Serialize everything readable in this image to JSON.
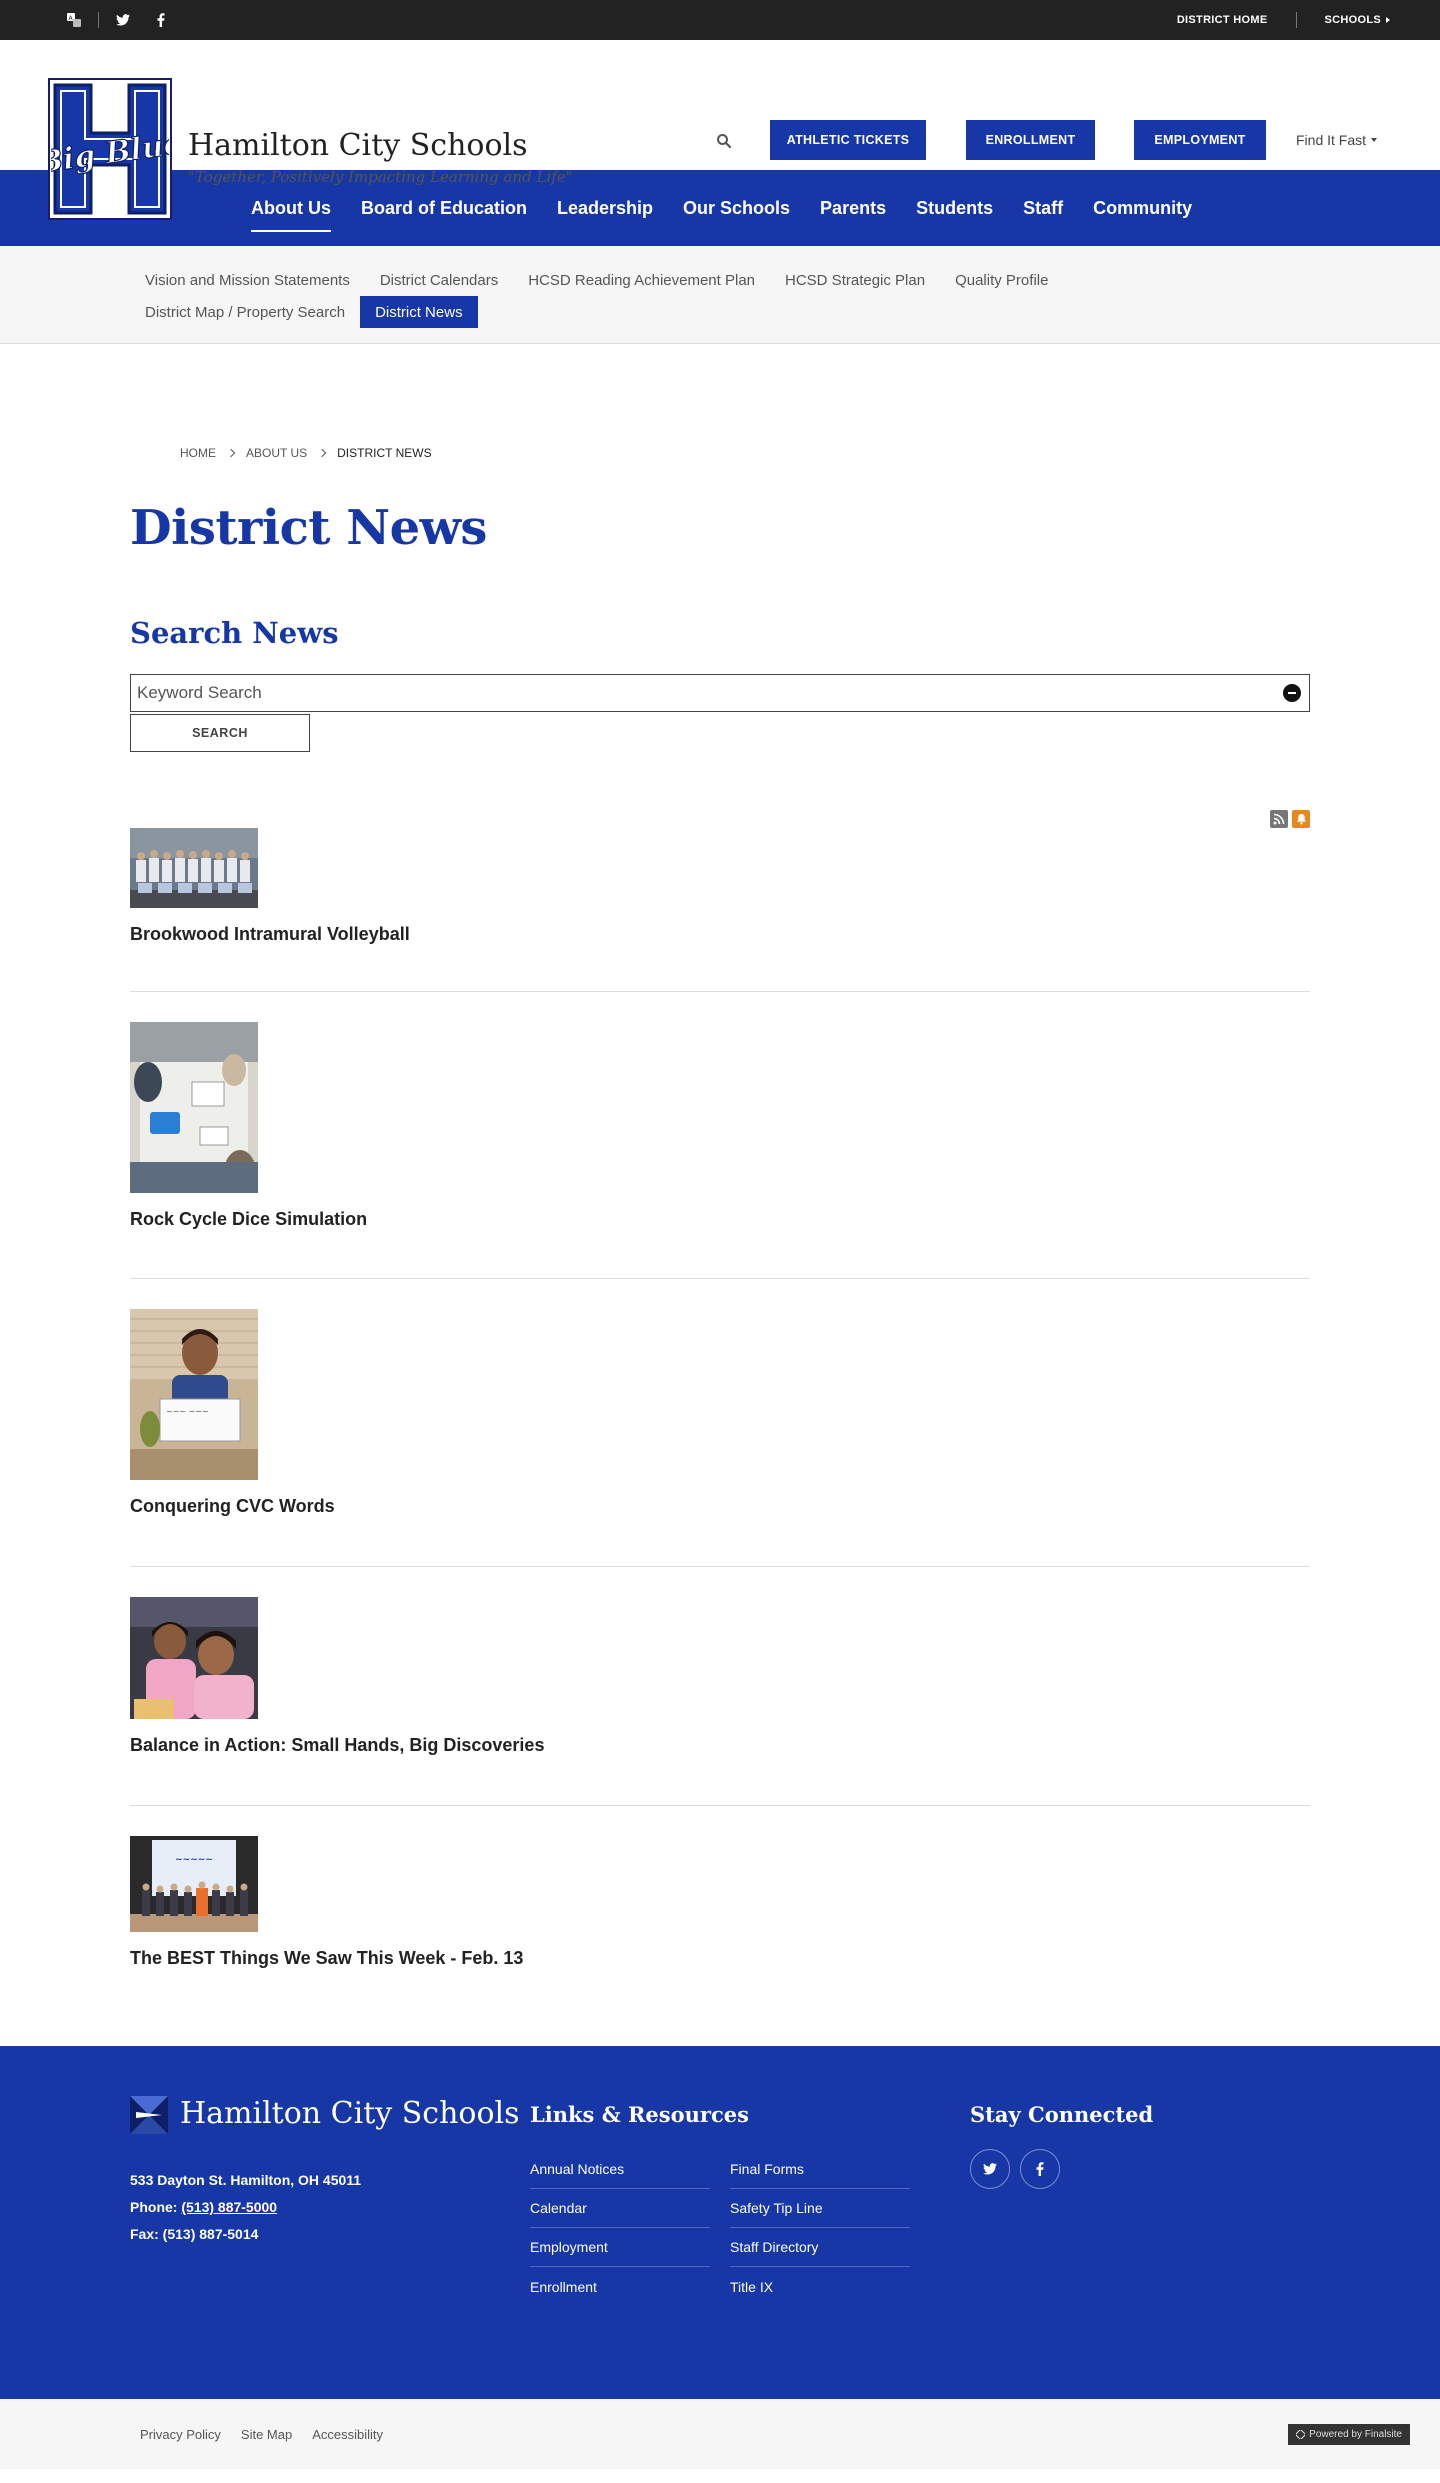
{
  "topbar": {
    "left_icons": [
      "translate-icon",
      "twitter-icon",
      "facebook-icon"
    ],
    "district_home": "DISTRICT HOME",
    "schools": "SCHOOLS"
  },
  "header": {
    "logo_text": "Big Blue",
    "site_name": "Hamilton City Schools",
    "tagline": "\"Together, Positively Impacting Learning and Life\"",
    "buttons": {
      "athletic_tickets": "ATHLETIC TICKETS",
      "enrollment": "ENROLLMENT",
      "employment": "EMPLOYMENT"
    },
    "find_it_fast": "Find It Fast"
  },
  "main_nav": {
    "items": [
      {
        "label": "About Us",
        "active": true
      },
      {
        "label": "Board of Education"
      },
      {
        "label": "Leadership"
      },
      {
        "label": "Our Schools"
      },
      {
        "label": "Parents"
      },
      {
        "label": "Students"
      },
      {
        "label": "Staff"
      },
      {
        "label": "Community"
      }
    ]
  },
  "sub_nav": {
    "row1": [
      "Vision and Mission Statements",
      "District Calendars",
      "HCSD Reading Achievement Plan",
      "HCSD Strategic Plan",
      "Quality Profile"
    ],
    "row2": [
      "District Map / Property Search",
      "District News"
    ],
    "active": "District News"
  },
  "breadcrumb": [
    "HOME",
    "ABOUT US",
    "DISTRICT NEWS"
  ],
  "page_title": "District News",
  "search": {
    "heading": "Search News",
    "placeholder": "Keyword Search",
    "button": "SEARCH"
  },
  "news": [
    {
      "title": "Brookwood Intramural Volleyball"
    },
    {
      "title": "Rock Cycle Dice Simulation"
    },
    {
      "title": "Conquering CVC Words"
    },
    {
      "title": "Balance in Action: Small Hands, Big Discoveries"
    },
    {
      "title": "The BEST Things We Saw This Week - Feb. 13"
    }
  ],
  "footer": {
    "name": "Hamilton City Schools",
    "address": "533 Dayton St. Hamilton, OH  45011",
    "phone_label": "Phone:",
    "phone": "(513) 887-5000",
    "fax": "Fax: (513) 887-5014",
    "links_heading": "Links & Resources",
    "links": [
      [
        "Annual Notices",
        "Final Forms"
      ],
      [
        "Calendar",
        "Safety Tip Line"
      ],
      [
        "Employment",
        "Staff Directory"
      ],
      [
        "Enrollment",
        "Title IX"
      ]
    ],
    "connected_heading": "Stay Connected"
  },
  "bottom": {
    "links": [
      "Privacy Policy",
      "Site Map",
      "Accessibility"
    ],
    "powered": "Powered by Finalsite"
  },
  "colors": {
    "brand_blue": "#1637a5",
    "dark_bar": "#222222"
  }
}
